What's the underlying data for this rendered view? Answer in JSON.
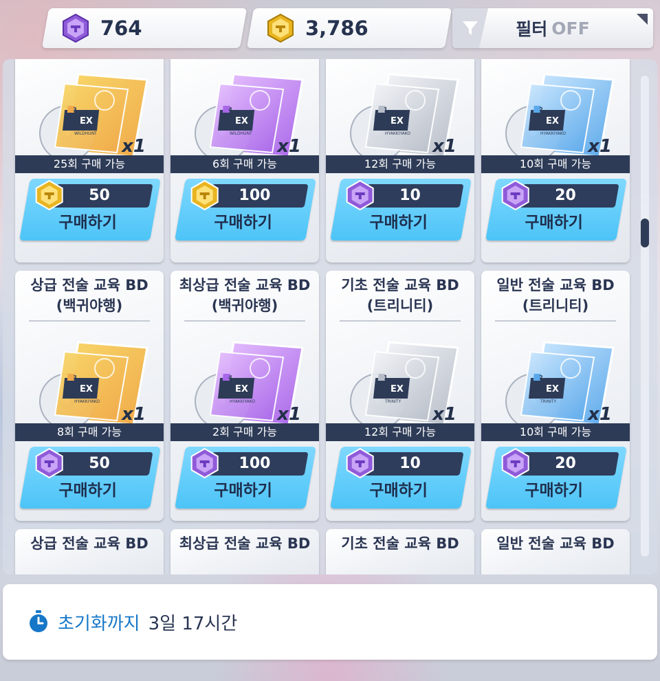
{
  "currencies": {
    "pyroxene": {
      "value": "764",
      "icon": "pyroxene-gem-icon"
    },
    "credit": {
      "value": "3,786",
      "icon": "gold-currency-icon"
    }
  },
  "filter": {
    "label": "필터",
    "state": "OFF"
  },
  "cards": [
    {
      "title": "",
      "quantity": "x1",
      "limit": "25회 구매 가능",
      "price": "50",
      "price_currency": "gold",
      "buy_label": "구매하기",
      "art_color": "gold",
      "art_grade": "3",
      "art_school": "WILDHUNT",
      "art_ex": "EX"
    },
    {
      "title": "",
      "quantity": "x1",
      "limit": "6회 구매 가능",
      "price": "100",
      "price_currency": "gold",
      "buy_label": "구매하기",
      "art_color": "purple",
      "art_grade": "4",
      "art_school": "WILDHUNT",
      "art_ex": "EX"
    },
    {
      "title": "",
      "quantity": "x1",
      "limit": "12회 구매 가능",
      "price": "10",
      "price_currency": "purple",
      "buy_label": "구매하기",
      "art_color": "silver",
      "art_grade": "1",
      "art_school": "HYAKKIYAKO",
      "art_ex": "EX"
    },
    {
      "title": "",
      "quantity": "x1",
      "limit": "10회 구매 가능",
      "price": "20",
      "price_currency": "purple",
      "buy_label": "구매하기",
      "art_color": "blue",
      "art_grade": "2",
      "art_school": "HYAKKIYAKO",
      "art_ex": "EX"
    },
    {
      "title": "상급 전술 교육 BD\n(백귀야행)",
      "quantity": "x1",
      "limit": "8회 구매 가능",
      "price": "50",
      "price_currency": "purple",
      "buy_label": "구매하기",
      "art_color": "gold",
      "art_grade": "3",
      "art_school": "HYAKKIYAKO",
      "art_ex": "EX"
    },
    {
      "title": "최상급 전술 교육 BD\n(백귀야행)",
      "quantity": "x1",
      "limit": "2회 구매 가능",
      "price": "100",
      "price_currency": "purple",
      "buy_label": "구매하기",
      "art_color": "purple",
      "art_grade": "4",
      "art_school": "HYAKKIYAKO",
      "art_ex": "EX"
    },
    {
      "title": "기초 전술 교육 BD\n(트리니티)",
      "quantity": "x1",
      "limit": "12회 구매 가능",
      "price": "10",
      "price_currency": "purple",
      "buy_label": "구매하기",
      "art_color": "silver",
      "art_grade": "1",
      "art_school": "TRINITY",
      "art_ex": "EX"
    },
    {
      "title": "일반 전술 교육 BD\n(트리니티)",
      "quantity": "x1",
      "limit": "10회 구매 가능",
      "price": "20",
      "price_currency": "purple",
      "buy_label": "구매하기",
      "art_color": "blue",
      "art_grade": "2",
      "art_school": "TRINITY",
      "art_ex": "EX"
    }
  ],
  "partial_titles": [
    "상급 전술 교육 BD",
    "최상급 전술 교육 BD",
    "기초 전술 교육 BD",
    "일반 전술 교육 BD"
  ],
  "reset": {
    "icon": "stopwatch-icon",
    "label": "초기화까지",
    "time": "3일 17시간"
  },
  "colors": {
    "gold": [
      "#f8d86a",
      "#f0a94a"
    ],
    "purple": [
      "#e7c2ff",
      "#a866e8"
    ],
    "silver": [
      "#f4f6f9",
      "#b7bdc8"
    ],
    "blue": [
      "#cfe9ff",
      "#5aa8ea"
    ],
    "button": "#4dc4f7",
    "dark": "#2d3b57",
    "accent_blue": "#1677c8"
  }
}
